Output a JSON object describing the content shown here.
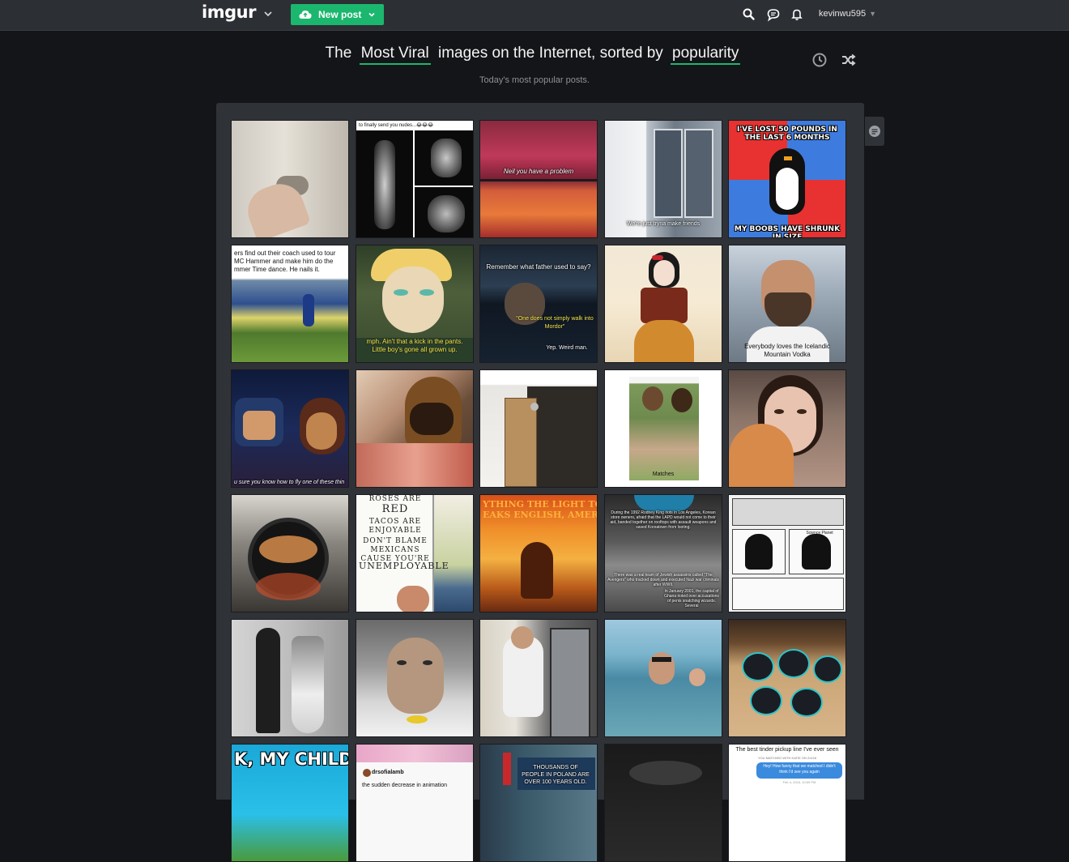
{
  "header": {
    "logo": "imgur",
    "new_post_label": "New post",
    "username": "kevinwu595"
  },
  "headline": {
    "prefix": "The",
    "section": "Most Viral",
    "middle": "images on the Internet, sorted by",
    "sort": "popularity",
    "subtitle": "Today's most popular posts."
  },
  "icons": {
    "search": "search-icon",
    "messages": "chat-icon",
    "notifications": "bell-icon",
    "history": "clock-icon",
    "random": "shuffle-icon",
    "comments": "comment-icon"
  },
  "colors": {
    "accent": "#1bb76e",
    "topbar": "#2c2f34",
    "background": "#141518",
    "panel": "#2f3237"
  },
  "gallery": {
    "rows": [
      [
        {
          "label": "Hand turning door knob",
          "captions": []
        },
        {
          "label": "Skeleton x-ray meme",
          "captions": [
            "to finally send you nudes...😂😂😂"
          ]
        },
        {
          "label": "Oscars crowd meme",
          "captions": [
            "Neil you have a problem"
          ]
        },
        {
          "label": "Movie night window",
          "captions": [
            "We're just tryna make friends"
          ]
        },
        {
          "label": "Socially awkward penguin",
          "captions": [
            "I'VE LOST 50 POUNDS IN THE LAST 6 MONTHS",
            "MY BOOBS HAVE SHRUNK IN SIZE"
          ]
        }
      ],
      [
        {
          "label": "Football team dance",
          "captions": [
            "ers find out their coach used to tour MC Hammer and make him do the mmer Time dance. He nails it."
          ]
        },
        {
          "label": "Cartoon villain",
          "captions": [
            "mph. Ain't that a kick in the pants. Little boy's gone all grown up."
          ]
        },
        {
          "label": "Game of Thrones meme",
          "captions": [
            "Remember what father used to say?",
            "\"One does not simply walk into Mordor\"",
            "Yep. Weird man."
          ]
        },
        {
          "label": "Disney princess painting",
          "captions": []
        },
        {
          "label": "Bearded man portrait",
          "captions": [
            "Everybody loves the Icelandic Mountain Vodka"
          ]
        }
      ],
      [
        {
          "label": "Batman cartoon",
          "captions": [
            "u sure you know how to fly one of these thin"
          ]
        },
        {
          "label": "Man with german shepherd",
          "captions": []
        },
        {
          "label": "Package by door",
          "captions": []
        },
        {
          "label": "Tinder matches",
          "captions": [
            "Matches"
          ]
        },
        {
          "label": "Woman with orange cat",
          "captions": []
        }
      ],
      [
        {
          "label": "Pizza on grill",
          "captions": []
        },
        {
          "label": "Protest sign",
          "captions": [
            "ROSES ARE",
            "RED",
            "TACOS ARE ENJOYABLE",
            "DON'T BLAME MEXICANS CAUSE YOU'RE",
            "UNEMPLOYABLE"
          ]
        },
        {
          "label": "Lion King sunset",
          "captions": [
            "YTHING THE LIGHT TO",
            "EAKS ENGLISH, AMERIC"
          ]
        },
        {
          "label": "History newspaper collage",
          "captions": [
            "During the 1992 Rodney King riots in Los Angeles, Korean store owners, afraid that the LAPD would not come to their aid, banded together on rooftops with assault weapons and saved Koreatown from looting.",
            "There was a real team of Jewish assassins called \"The Avengers\" who tracked down and executed Nazi war criminals after WWII.",
            "In January 2001, the capital of Ghana rioted over accusations of penis snatching wizards. Several"
          ]
        },
        {
          "label": "Science comic",
          "captions": [
            "Science Planet"
          ]
        }
      ],
      [
        {
          "label": "Black and white fashion photo",
          "captions": []
        },
        {
          "label": "Fluffy kitten",
          "captions": []
        },
        {
          "label": "Elevator office scene",
          "captions": []
        },
        {
          "label": "Swimmers in ocean",
          "captions": []
        },
        {
          "label": "Black cookies on tray",
          "captions": []
        }
      ],
      [
        {
          "label": "Cartoon meme",
          "captions": [
            "K, MY CHILDREN"
          ]
        },
        {
          "label": "Tweet screenshot",
          "captions": [
            "drsofialamb",
            "the sudden decrease in animation"
          ]
        },
        {
          "label": "Billboard",
          "captions": [
            "THOUSANDS OF PEOPLE IN POLAND ARE OVER 100 YEARS OLD."
          ]
        },
        {
          "label": "Dark photo",
          "captions": []
        },
        {
          "label": "Tinder pickup line",
          "captions": [
            "The best tinder pickup line I've ever seen",
            "YOU MATCHED WITH KATIE ON 2/4/16",
            "Hey! How funny that we matched I didn't think I'd see you again",
            "Feb 4, 2016, 10:59 PM"
          ]
        }
      ]
    ]
  }
}
